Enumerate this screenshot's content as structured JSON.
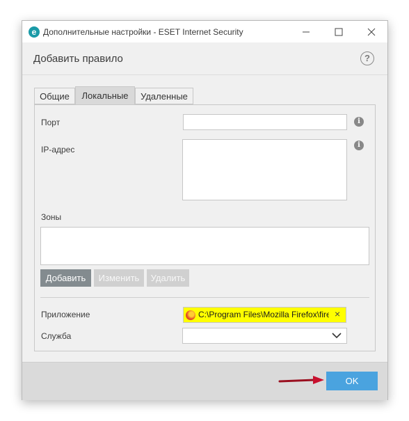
{
  "window": {
    "title": "Дополнительные настройки - ESET Internet Security",
    "app_icon_letter": "e",
    "icons": [
      "minimize-icon",
      "maximize-icon",
      "close-icon"
    ]
  },
  "dialog": {
    "title": "Добавить правило",
    "help_glyph": "?"
  },
  "tabs": [
    {
      "label": "Общие",
      "active": false
    },
    {
      "label": "Локальные",
      "active": true
    },
    {
      "label": "Удаленные",
      "active": false
    }
  ],
  "form": {
    "port": {
      "label": "Порт",
      "value": ""
    },
    "ip": {
      "label": "IP-адрес",
      "value": ""
    },
    "info_glyph": "i",
    "zones": {
      "label": "Зоны",
      "value": ""
    },
    "zone_buttons": {
      "add": "Добавить",
      "edit": "Изменить",
      "delete": "Удалить"
    },
    "application": {
      "label": "Приложение",
      "value": "C:\\Program Files\\Mozilla Firefox\\firefox.exe",
      "clear_glyph": "×",
      "highlight_color": "#ffff00"
    },
    "service": {
      "label": "Служба",
      "value": ""
    }
  },
  "footer": {
    "ok_label": "OK"
  },
  "colors": {
    "accent": "#4aa3df",
    "arrow": "#c8102e"
  }
}
